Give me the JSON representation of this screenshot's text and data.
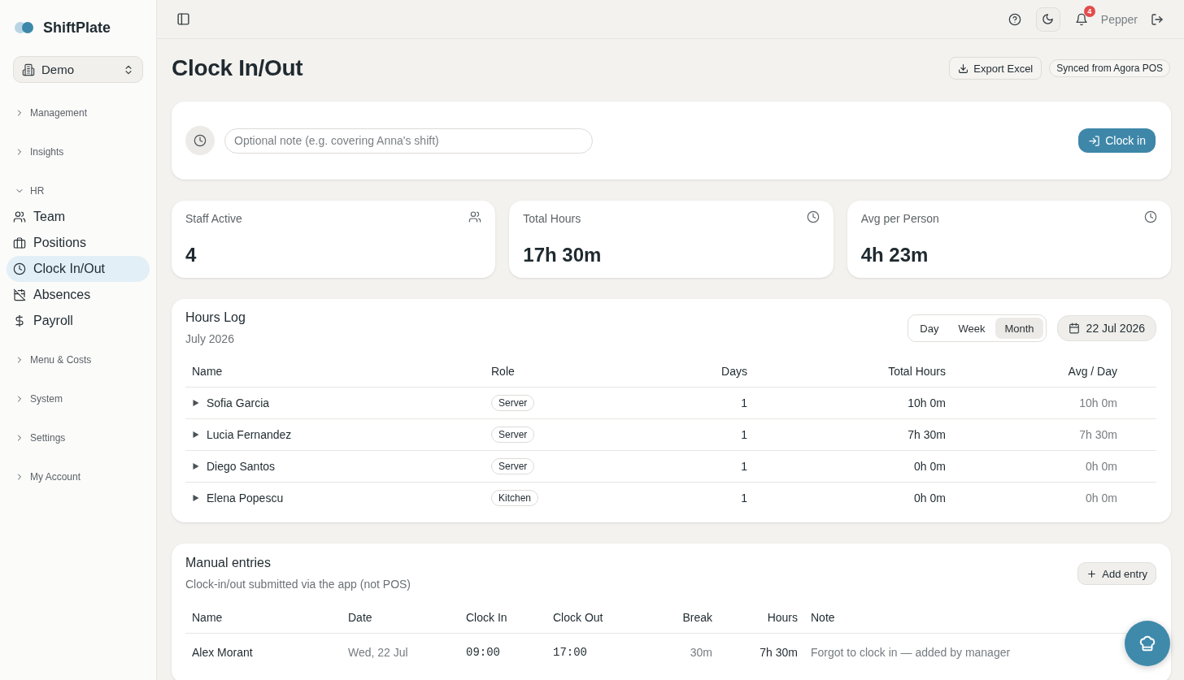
{
  "sidebar": {
    "brand": "ShiftPlate",
    "workspace": "Demo",
    "sections": [
      {
        "label": "Management",
        "expanded": false
      },
      {
        "label": "Insights",
        "expanded": false
      },
      {
        "label": "HR",
        "expanded": true,
        "children": [
          {
            "label": "Team",
            "selected": false
          },
          {
            "label": "Positions",
            "selected": false
          },
          {
            "label": "Clock In/Out",
            "selected": true
          },
          {
            "label": "Absences",
            "selected": false
          },
          {
            "label": "Payroll",
            "selected": false
          }
        ]
      },
      {
        "label": "Menu & Costs",
        "expanded": false
      },
      {
        "label": "System",
        "expanded": false
      },
      {
        "label": "Settings",
        "expanded": false
      },
      {
        "label": "My Account",
        "expanded": false
      }
    ]
  },
  "topbar": {
    "notification_count": "4",
    "user_name": "Pepper"
  },
  "page": {
    "title": "Clock In/Out",
    "export_button": "Export Excel",
    "sync_badge": "Synced from Agora POS"
  },
  "clock_card": {
    "note": {
      "placeholder": "Optional note (e.g. covering Anna's shift)"
    },
    "button": "Clock in"
  },
  "stats": [
    {
      "label": "Staff Active",
      "value": "4"
    },
    {
      "label": "Total Hours",
      "value": "17h 30m"
    },
    {
      "label": "Avg per Person",
      "value": "4h 23m"
    }
  ],
  "hours_log": {
    "title": "Hours Log",
    "subtitle": "July 2026",
    "periods": [
      {
        "label": "Day",
        "selected": false
      },
      {
        "label": "Week",
        "selected": false
      },
      {
        "label": "Month",
        "selected": true
      }
    ],
    "date": "22 Jul 2026",
    "columns": [
      "Name",
      "Role",
      "Days",
      "Total Hours",
      "Avg / Day"
    ],
    "rows": [
      {
        "name": "Sofia Garcia",
        "role": "Server",
        "days": "1",
        "total_hours": "10h 0m",
        "avg_per_day": "10h 0m",
        "expanded": false
      },
      {
        "name": "Lucia Fernandez",
        "role": "Server",
        "days": "1",
        "total_hours": "7h 30m",
        "avg_per_day": "7h 30m",
        "expanded": false
      },
      {
        "name": "Diego Santos",
        "role": "Server",
        "days": "1",
        "total_hours": "0h 0m",
        "avg_per_day": "0h 0m",
        "expanded": false
      },
      {
        "name": "Elena Popescu",
        "role": "Kitchen",
        "days": "1",
        "total_hours": "0h 0m",
        "avg_per_day": "0h 0m",
        "expanded": false
      }
    ]
  },
  "manual_entries": {
    "title": "Manual entries",
    "subtitle": "Clock-in/out submitted via the app (not POS)",
    "add_button": "Add entry",
    "columns": [
      "Name",
      "Date",
      "Clock In",
      "Clock Out",
      "Break",
      "Hours",
      "Note"
    ],
    "rows": [
      {
        "name": "Alex Morant",
        "date": "Wed, 22 Jul",
        "clock_in": "09:00",
        "clock_out": "17:00",
        "break": "30m",
        "hours": "7h 30m",
        "note": "Forgot to clock in — added by manager"
      }
    ]
  }
}
